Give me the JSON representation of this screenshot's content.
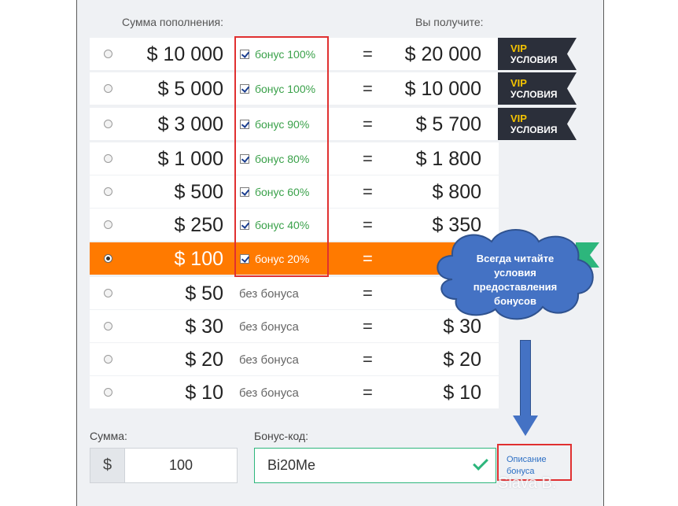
{
  "header": {
    "amount_label": "Сумма пополнения:",
    "receive_label": "Вы получите:"
  },
  "rows": [
    {
      "amount": "$ 10 000",
      "bonus": "бонус 100%",
      "has_bonus": true,
      "eq": "=",
      "result": "$ 20 000",
      "selected": false
    },
    {
      "amount": "$ 5 000",
      "bonus": "бонус 100%",
      "has_bonus": true,
      "eq": "=",
      "result": "$ 10 000",
      "selected": false
    },
    {
      "amount": "$ 3 000",
      "bonus": "бонус 90%",
      "has_bonus": true,
      "eq": "=",
      "result": "$ 5 700",
      "selected": false
    },
    {
      "amount": "$ 1 000",
      "bonus": "бонус 80%",
      "has_bonus": true,
      "eq": "=",
      "result": "$ 1 800",
      "selected": false
    },
    {
      "amount": "$ 500",
      "bonus": "бонус 60%",
      "has_bonus": true,
      "eq": "=",
      "result": "$ 800",
      "selected": false
    },
    {
      "amount": "$ 250",
      "bonus": "бонус 40%",
      "has_bonus": true,
      "eq": "=",
      "result": "$ 350",
      "selected": false
    },
    {
      "amount": "$ 100",
      "bonus": "бонус 20%",
      "has_bonus": true,
      "eq": "=",
      "result": "",
      "selected": true
    },
    {
      "amount": "$ 50",
      "bonus": "без бонуса",
      "has_bonus": false,
      "eq": "=",
      "result": "",
      "selected": false
    },
    {
      "amount": "$ 30",
      "bonus": "без бонуса",
      "has_bonus": false,
      "eq": "=",
      "result": "$ 30",
      "selected": false
    },
    {
      "amount": "$ 20",
      "bonus": "без бонуса",
      "has_bonus": false,
      "eq": "=",
      "result": "$ 20",
      "selected": false
    },
    {
      "amount": "$ 10",
      "bonus": "без бонуса",
      "has_bonus": false,
      "eq": "=",
      "result": "$ 10",
      "selected": false
    }
  ],
  "vip_badges": [
    {
      "top": "VIP",
      "bottom": "УСЛОВИЯ"
    },
    {
      "top": "VIP",
      "bottom": "УСЛОВИЯ"
    },
    {
      "top": "VIP",
      "bottom": "УСЛОВИЯ"
    }
  ],
  "callout": {
    "text": "Всегда читайте условия предоставления бонусов"
  },
  "form": {
    "sum_label": "Сумма:",
    "currency_symbol": "$",
    "sum_value": "100",
    "code_label": "Бонус-код:",
    "code_value": "Bi20Me",
    "description_link": "Описание бонуса"
  },
  "watermark": "Slava B.",
  "colors": {
    "selected_row": "#ff7a00",
    "bonus_text": "#3aa14a",
    "vip_bg": "#2b2f3a",
    "vip_text": "#f5c400",
    "highlight": "#e03030",
    "callout": "#4472c4",
    "valid": "#2db67c"
  }
}
